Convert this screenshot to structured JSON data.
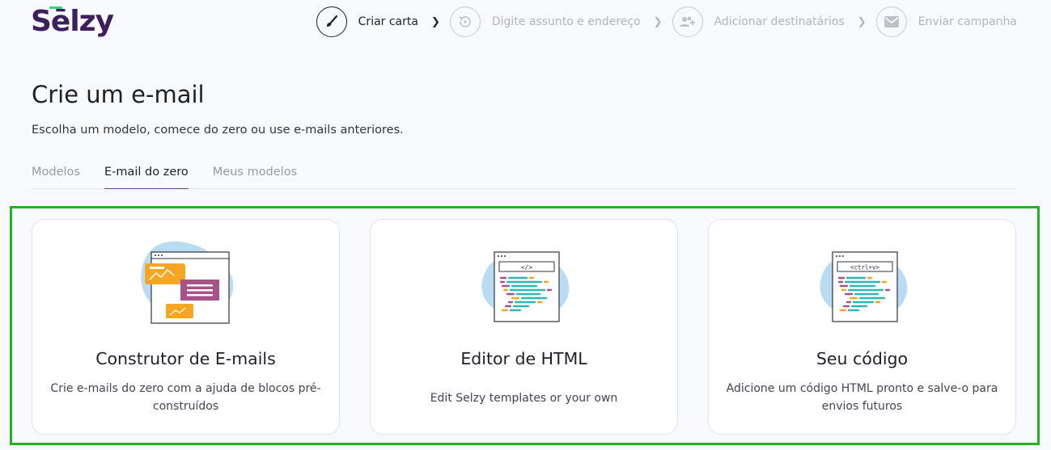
{
  "logo": "Sēlzy",
  "steps": [
    {
      "label": "Criar carta",
      "icon": "brush-icon",
      "active": true
    },
    {
      "label": "Digite assunto e endereço",
      "icon": "refresh-icon",
      "active": false
    },
    {
      "label": "Adicionar destinatários",
      "icon": "add-users-icon",
      "active": false
    },
    {
      "label": "Enviar campanha",
      "icon": "envelope-icon",
      "active": false
    }
  ],
  "page": {
    "title": "Crie um e-mail",
    "subtitle": "Escolha um modelo, comece do zero ou use e-mails anteriores."
  },
  "tabs": [
    {
      "label": "Modelos",
      "active": false
    },
    {
      "label": "E-mail do zero",
      "active": true
    },
    {
      "label": "Meus modelos",
      "active": false
    }
  ],
  "cards": [
    {
      "title": "Construtor de E-mails",
      "description": "Crie e-mails do zero com a ajuda de blocos pré-construídos",
      "illustration": "builder-illustration"
    },
    {
      "title": "Editor de HTML",
      "description": "Edit Selzy templates or your own",
      "illustration": "html-editor-illustration",
      "code_tag": "</>"
    },
    {
      "title": "Seu código",
      "description": "Adicione um código HTML pronto e salve-o para envios futuros",
      "illustration": "paste-code-illustration",
      "code_tag": "<ctrl+v>"
    }
  ],
  "colors": {
    "brand": "#3d1f5c",
    "accent_green": "#2fd67a",
    "highlight": "#22b322",
    "tab_underline": "#6e3c8c"
  }
}
